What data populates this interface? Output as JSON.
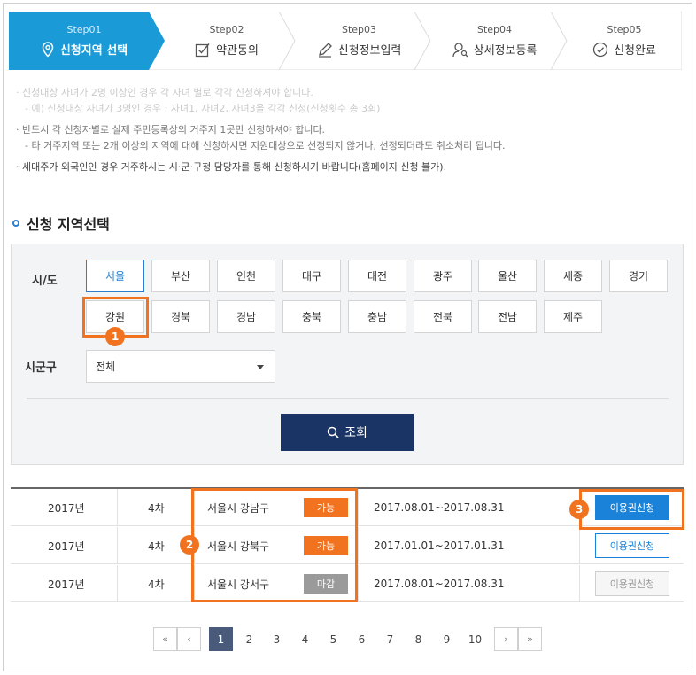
{
  "steps": [
    {
      "num": "Step01",
      "label": "신청지역 선택",
      "icon": "map-pin-icon",
      "active": true
    },
    {
      "num": "Step02",
      "label": "약관동의",
      "icon": "checkbox-icon",
      "active": false
    },
    {
      "num": "Step03",
      "label": "신청정보입력",
      "icon": "pencil-icon",
      "active": false
    },
    {
      "num": "Step04",
      "label": "상세정보등록",
      "icon": "user-search-icon",
      "active": false
    },
    {
      "num": "Step05",
      "label": "신청완료",
      "icon": "check-circle-icon",
      "active": false
    }
  ],
  "notes": {
    "line1": "· 신청대상 자녀가 2명 이상인 경우 각 자녀 별로 각각 신청하셔야 합니다.",
    "line2": "- 예) 신청대상 자녀가 3명인 경우 : 자녀1, 자녀2, 자녀3을 각각 신청(신청횟수 총 3회)",
    "line3": "· 반드시 각 신청자별로 실제 주민등록상의 거주지 1곳만 신청하셔야 합니다.",
    "line4": "- 타 거주지역 또는 2개 이상의 지역에 대해 신청하시면 지원대상으로 선정되지 않거나, 선정되더라도 취소처리 됩니다.",
    "line5": "· 세대주가 외국인인 경우 거주하시는 시·군·구청 담당자를 통해 신청하시기 바랍니다(홈페이지 신청 불가)."
  },
  "section_title": "신청 지역선택",
  "region": {
    "sido_label": "시/도",
    "sigungu_label": "시군구",
    "sido_row1": [
      "서울",
      "부산",
      "인천",
      "대구",
      "대전",
      "광주",
      "울산",
      "세종",
      "경기"
    ],
    "sido_row2": [
      "강원",
      "경북",
      "경남",
      "충북",
      "충남",
      "전북",
      "전남",
      "제주"
    ],
    "sigungu_value": "전체",
    "search_label": "조회"
  },
  "table": {
    "rows": [
      {
        "year": "2017년",
        "round": "4차",
        "region": "서울시 강남구",
        "status": "가능",
        "period": "2017.08.01~2017.08.31",
        "action": "이용권신청"
      },
      {
        "year": "2017년",
        "round": "4차",
        "region": "서울시 강북구",
        "status": "가능",
        "period": "2017.01.01~2017.01.31",
        "action": "이용권신청"
      },
      {
        "year": "2017년",
        "round": "4차",
        "region": "서울시 강서구",
        "status": "마감",
        "period": "2017.08.01~2017.08.31",
        "action": "이용권신청"
      }
    ]
  },
  "pagination": {
    "first": "«",
    "prev": "‹",
    "next": "›",
    "last": "»",
    "pages": [
      "1",
      "2",
      "3",
      "4",
      "5",
      "6",
      "7",
      "8",
      "9",
      "10"
    ],
    "current": "1"
  },
  "markers": [
    "1",
    "2",
    "3"
  ],
  "colors": {
    "step_active": "#1a9ad6",
    "accent_blue": "#2a7fd0",
    "search_button": "#1b3466",
    "status_open": "#f2731f",
    "status_closed": "#9a9a9a",
    "highlight": "#f2731f"
  }
}
